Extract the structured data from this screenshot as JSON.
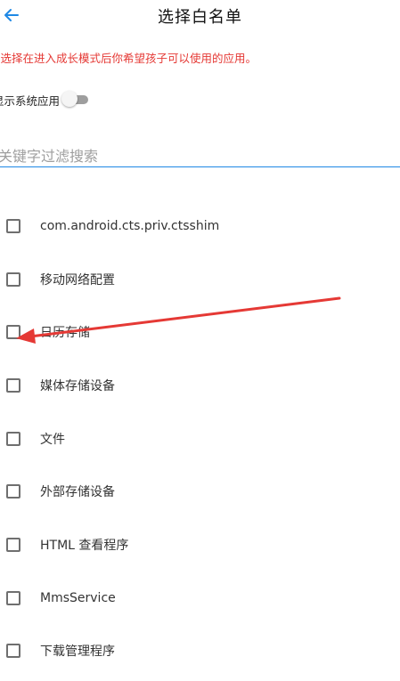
{
  "header": {
    "title": "选择白名单",
    "back_icon": "arrow-left-icon"
  },
  "notice": {
    "text": "请选择在进入成长模式后你希望孩子可以使用的应用。",
    "color": "#e53935"
  },
  "system_toggle": {
    "label": "显示系统应用",
    "state": "off"
  },
  "search": {
    "placeholder": "关键字过滤搜索",
    "value": ""
  },
  "apps": [
    {
      "label": "com.android.cts.priv.ctsshim",
      "checked": false
    },
    {
      "label": "移动网络配置",
      "checked": false
    },
    {
      "label": "日历存储",
      "checked": false
    },
    {
      "label": "媒体存储设备",
      "checked": false
    },
    {
      "label": "文件",
      "checked": false
    },
    {
      "label": "外部存储设备",
      "checked": false
    },
    {
      "label": "HTML 查看程序",
      "checked": false
    },
    {
      "label": "MmsService",
      "checked": false
    },
    {
      "label": "下载管理程序",
      "checked": false
    }
  ],
  "colors": {
    "accent": "#1e88e5",
    "annotation_arrow": "#e53935"
  }
}
